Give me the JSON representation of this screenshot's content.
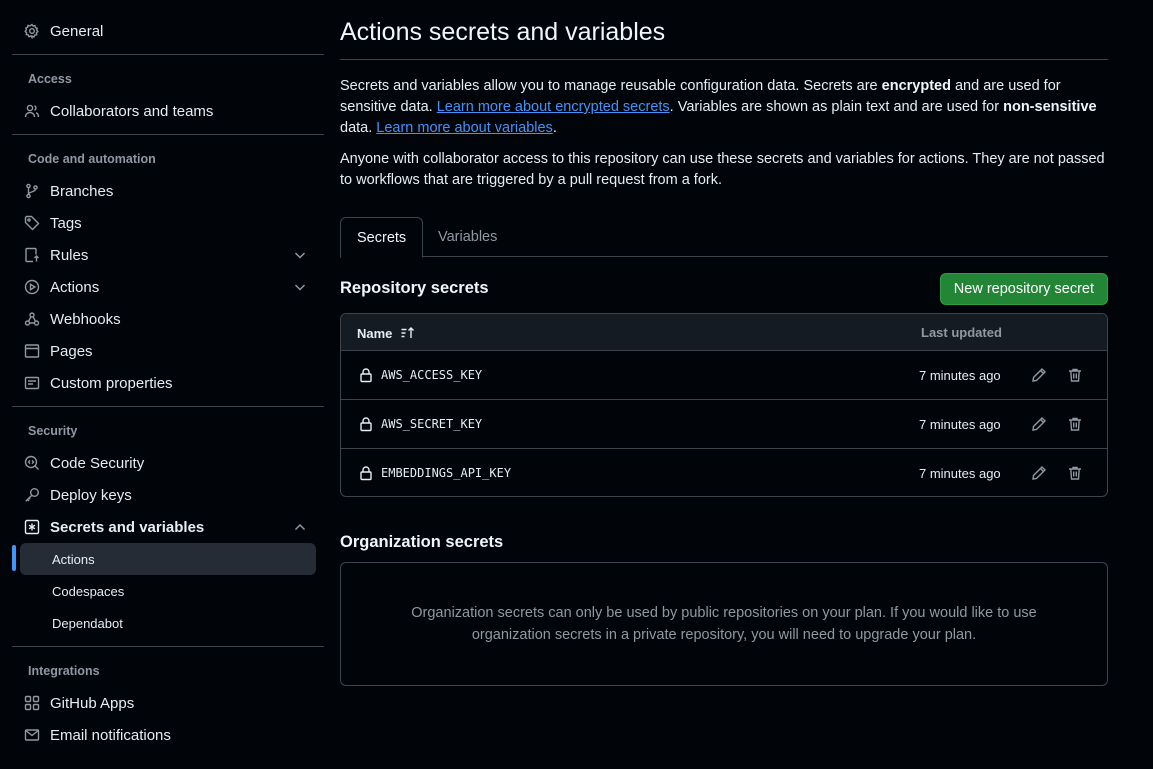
{
  "sidebar": {
    "general": "General",
    "sections": {
      "access": "Access",
      "code": "Code and automation",
      "security": "Security",
      "integrations": "Integrations"
    },
    "items": {
      "collaborators": "Collaborators and teams",
      "branches": "Branches",
      "tags": "Tags",
      "rules": "Rules",
      "actions": "Actions",
      "webhooks": "Webhooks",
      "pages": "Pages",
      "custom_properties": "Custom properties",
      "code_security": "Code Security",
      "deploy_keys": "Deploy keys",
      "secrets_and_variables": "Secrets and variables",
      "github_apps": "GitHub Apps",
      "email_notifications": "Email notifications"
    },
    "sub_items": {
      "actions": "Actions",
      "codespaces": "Codespaces",
      "dependabot": "Dependabot"
    }
  },
  "main": {
    "title": "Actions secrets and variables",
    "intro": {
      "p1_a": "Secrets and variables allow you to manage reusable configuration data. Secrets are ",
      "p1_bold1": "encrypted",
      "p1_b": " and are used for sensitive data. ",
      "p1_link1": "Learn more about encrypted secrets",
      "p1_c": ". Variables are shown as plain text and are used for ",
      "p1_bold2": "non-sensitive",
      "p1_d": " data. ",
      "p1_link2": "Learn more about variables",
      "p1_e": ".",
      "p2": "Anyone with collaborator access to this repository can use these secrets and variables for actions. They are not passed to workflows that are triggered by a pull request from a fork."
    },
    "tabs": {
      "secrets": "Secrets",
      "variables": "Variables"
    },
    "repo_secrets_heading": "Repository secrets",
    "new_secret_button": "New repository secret",
    "table": {
      "col_name": "Name",
      "col_updated": "Last updated",
      "rows": [
        {
          "name": "AWS_ACCESS_KEY",
          "updated": "7 minutes ago"
        },
        {
          "name": "AWS_SECRET_KEY",
          "updated": "7 minutes ago"
        },
        {
          "name": "EMBEDDINGS_API_KEY",
          "updated": "7 minutes ago"
        }
      ]
    },
    "org_secrets_heading": "Organization secrets",
    "org_secrets_message": "Organization secrets can only be used by public repositories on your plan. If you would like to use organization secrets in a private repository, you will need to upgrade your plan."
  },
  "colors": {
    "background": "#010409",
    "accent_link": "#4493f8",
    "primary_button": "#238636",
    "border": "#3d444d",
    "muted_text": "#9198a1"
  }
}
